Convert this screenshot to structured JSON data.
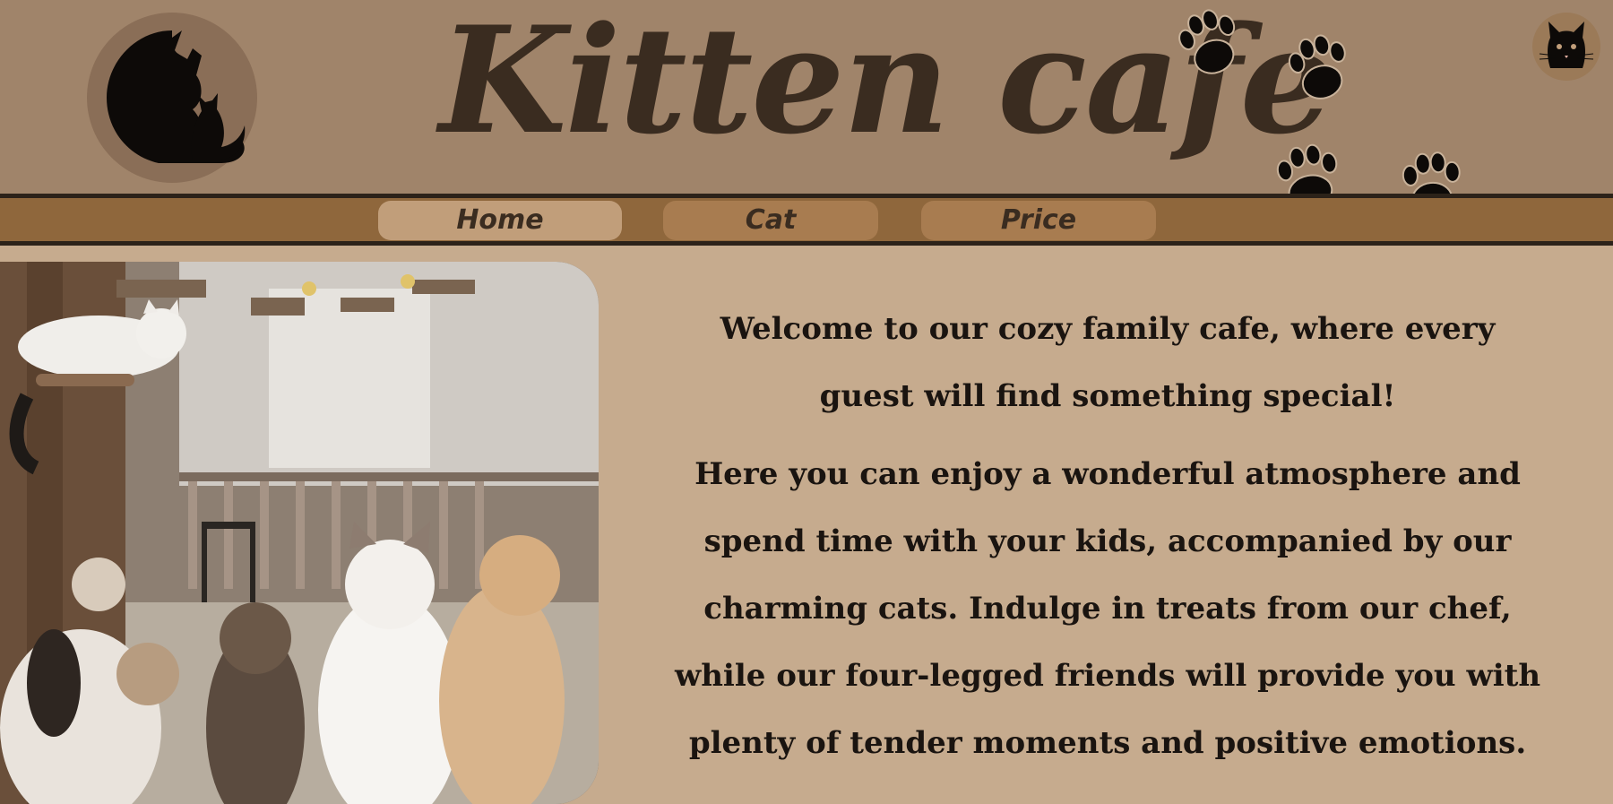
{
  "header": {
    "title": "Kitten cafe",
    "logo_icon": "cat-silhouette-logo-icon",
    "corner_icon": "cat-face-icon",
    "decor_icon": "paw-print-icon"
  },
  "nav": {
    "items": [
      {
        "label": "Home",
        "active": true
      },
      {
        "label": "Cat",
        "active": false
      },
      {
        "label": "Price",
        "active": false
      }
    ]
  },
  "main": {
    "image_alt": "cats in cafe",
    "paragraphs": [
      "Welcome to our cozy family cafe, where every guest will find something special!",
      "Here you can enjoy a wonderful atmosphere and spend time with your kids, accompanied by our charming cats. Indulge in treats from our chef, while our four-legged friends will provide you with plenty of tender moments and positive emotions."
    ]
  },
  "colors": {
    "header_bg": "#a0846a",
    "nav_bg": "#8f673c",
    "page_bg": "#c6ab8e",
    "text": "#1a1410"
  }
}
